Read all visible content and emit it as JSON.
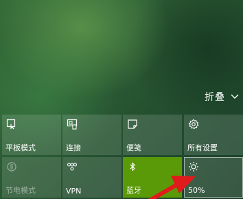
{
  "header": {
    "collapse_label": "折叠",
    "collapse_icon": "chevron-down-icon"
  },
  "tiles": [
    {
      "label": "平板模式",
      "icon": "tablet-mode-icon"
    },
    {
      "label": "连接",
      "icon": "connect-icon"
    },
    {
      "label": "便笺",
      "icon": "note-icon"
    },
    {
      "label": "所有设置",
      "icon": "gear-icon"
    },
    {
      "label": "节电模式",
      "icon": "battery-saver-icon",
      "state": "disabled"
    },
    {
      "label": "VPN",
      "icon": "vpn-icon"
    },
    {
      "label": "蓝牙",
      "icon": "bluetooth-icon",
      "state": "on"
    },
    {
      "label": "50%",
      "icon": "brightness-icon"
    }
  ],
  "annotation": {
    "icon": "red-arrow-annotation"
  },
  "colors": {
    "accent": "#5a9a08",
    "tile": "#ffffff22",
    "arrow": "#e11b1b"
  }
}
